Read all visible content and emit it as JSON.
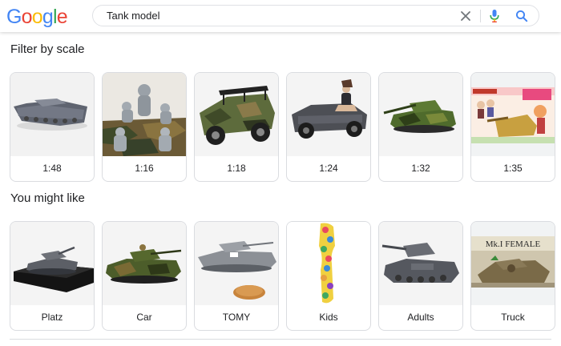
{
  "search": {
    "query": "Tank model"
  },
  "logo": {
    "letters": [
      "G",
      "o",
      "o",
      "g",
      "l",
      "e"
    ],
    "colors": [
      "#4285F4",
      "#EA4335",
      "#FBBC05",
      "#4285F4",
      "#34A853",
      "#EA4335"
    ]
  },
  "icons": {
    "clear": "close-icon",
    "voice": "microphone-icon",
    "search": "search-icon"
  },
  "sections": {
    "scale_title": "Filter by scale",
    "like_title": "You might like"
  },
  "scale_cards": [
    {
      "label": "1:48",
      "image": "grey-tank-model"
    },
    {
      "label": "1:16",
      "image": "camo-tank-figures"
    },
    {
      "label": "1:18",
      "image": "camo-jeep-model"
    },
    {
      "label": "1:24",
      "image": "grey-kubelwagen-figure"
    },
    {
      "label": "1:32",
      "image": "green-tank-model"
    },
    {
      "label": "1:35",
      "image": "anime-box-art"
    }
  ],
  "like_cards": [
    {
      "label": "Platz",
      "image": "grey-tank-on-base"
    },
    {
      "label": "Car",
      "image": "green-tank-model"
    },
    {
      "label": "TOMY",
      "image": "small-tank-with-coin"
    },
    {
      "label": "Kids",
      "image": "colorful-tank-strip"
    },
    {
      "label": "Adults",
      "image": "grey-panzer-model"
    },
    {
      "label": "Truck",
      "image": "mk-i-female-box-art"
    }
  ],
  "box_art": {
    "mk_title": "Mk.I FEMALE"
  }
}
